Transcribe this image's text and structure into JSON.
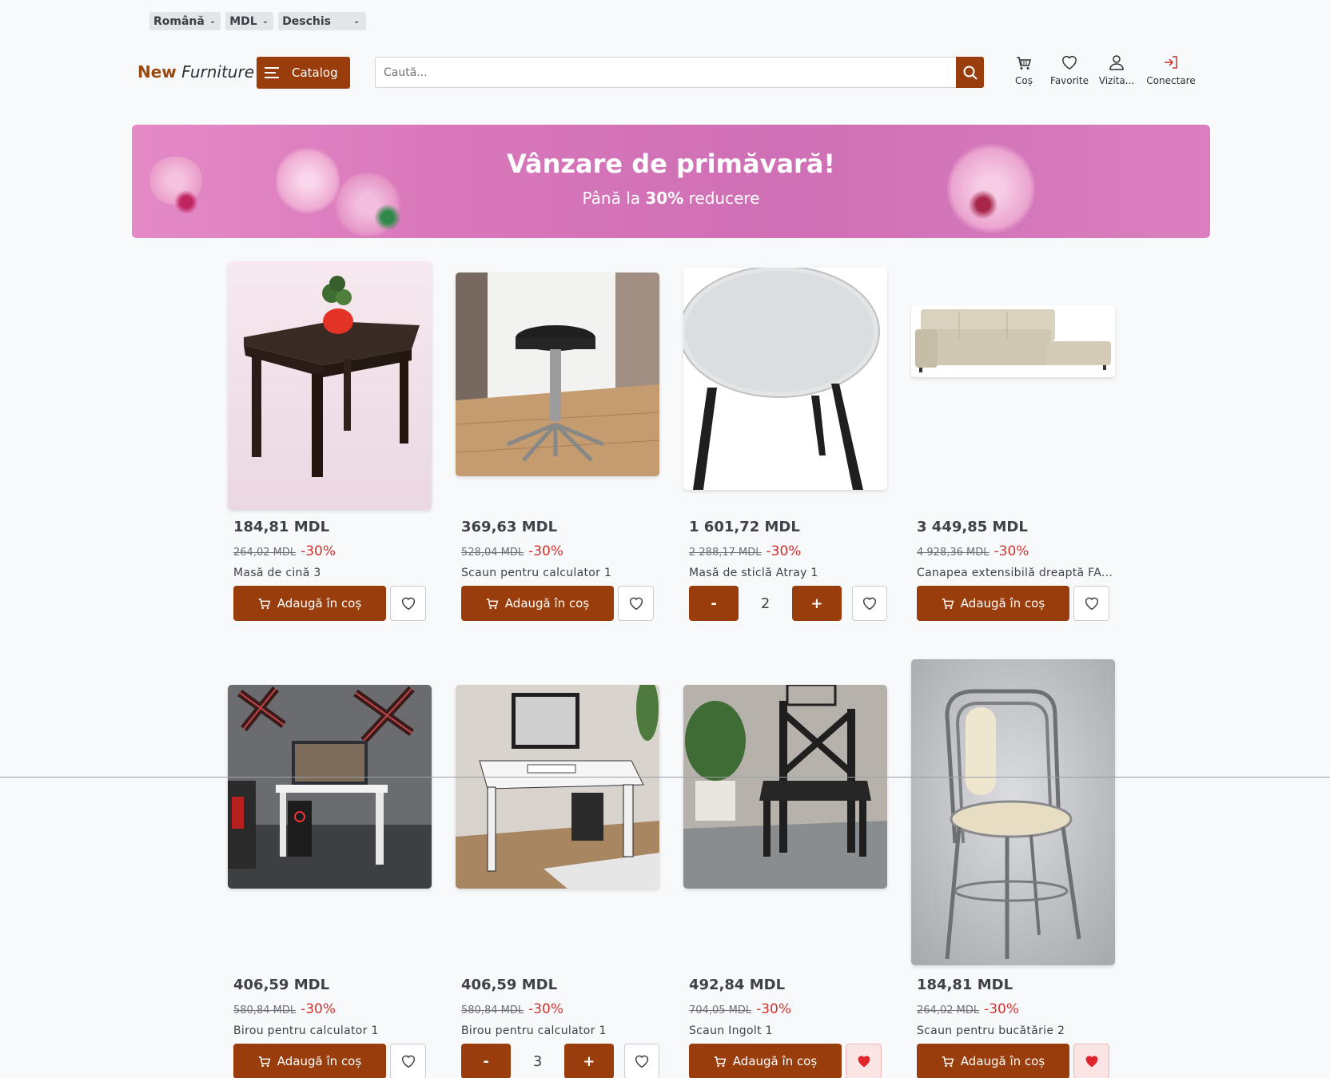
{
  "topbar": {
    "language": "Română",
    "currency": "MDL",
    "theme": "Deschis"
  },
  "header": {
    "logo_new": "New",
    "logo_furniture": "Furniture",
    "catalog_label": "Catalog",
    "search_placeholder": "Caută...",
    "cart_label": "Coș",
    "favorites_label": "Favorite",
    "visitor_label": "Vizita...",
    "login_label": "Conectare"
  },
  "banner": {
    "title": "Vânzare de primăvară!",
    "sub_before": "Până la",
    "sub_bold": "30%",
    "sub_after": "reducere"
  },
  "add_label": "Adaugă în coș",
  "products": [
    {
      "price": "184,81 MDL",
      "old_price": "264,02 MDL",
      "discount": "-30%",
      "name": "Masă de cină 3"
    },
    {
      "price": "369,63 MDL",
      "old_price": "528,04 MDL",
      "discount": "-30%",
      "name": "Scaun pentru calculator 1"
    },
    {
      "price": "1 601,72 MDL",
      "old_price": "2 288,17 MDL",
      "discount": "-30%",
      "name": "Masă de sticlă Atray 1",
      "qty_minus": "-",
      "qty": "2",
      "qty_plus": "+"
    },
    {
      "price": "3 449,85 MDL",
      "old_price": "4 928,36 MDL",
      "discount": "-30%",
      "name": "Canapea extensibilă dreaptă FA..."
    },
    {
      "price": "406,59 MDL",
      "old_price": "580,84 MDL",
      "discount": "-30%",
      "name": "Birou pentru calculator 1"
    },
    {
      "price": "406,59 MDL",
      "old_price": "580,84 MDL",
      "discount": "-30%",
      "name": "Birou pentru calculator 1",
      "qty_minus": "-",
      "qty": "3",
      "qty_plus": "+"
    },
    {
      "price": "492,84 MDL",
      "old_price": "704,05 MDL",
      "discount": "-30%",
      "name": "Scaun Ingolt 1",
      "favorited": true
    },
    {
      "price": "184,81 MDL",
      "old_price": "264,02 MDL",
      "discount": "-30%",
      "name": "Scaun pentru bucătărie 2",
      "favorited": true
    }
  ],
  "colors": {
    "accent": "#9a3d0c",
    "discount": "#d0312d",
    "favorite_active": "#e0242c"
  }
}
